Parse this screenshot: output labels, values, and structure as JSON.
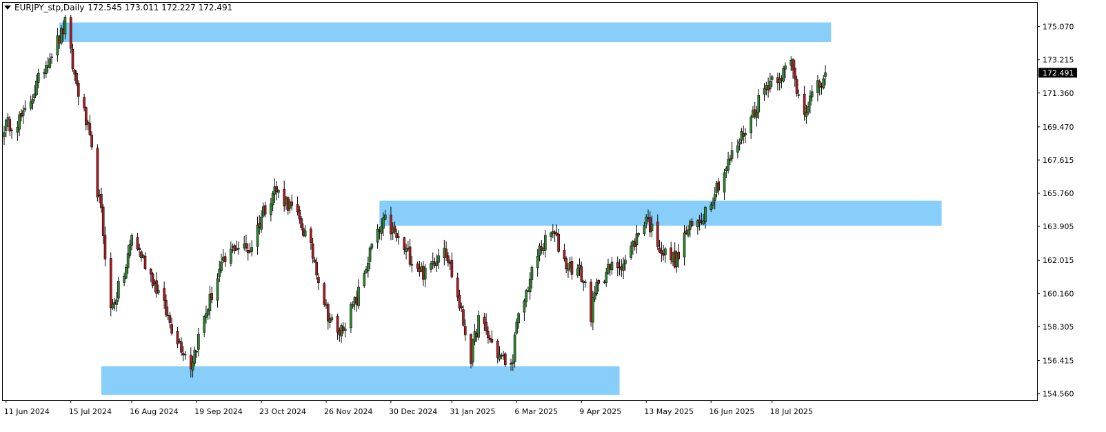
{
  "header": {
    "symbol": "EURJPY_stp,Daily",
    "ohlc": "172.545 173.011 172.227 172.491"
  },
  "colors": {
    "zone": "#87cefa",
    "bull": "#2e8b2e",
    "bear": "#b01d22",
    "wick": "#000000",
    "price_label_bg": "#000000",
    "price_label_text": "#ffffff"
  },
  "chart_data": {
    "type": "candlestick",
    "symbol": "EURJPY_stp",
    "timeframe": "Daily",
    "last_price": "172.491",
    "y_ticks": [
      "175.070",
      "173.215",
      "171.360",
      "169.470",
      "167.615",
      "165.760",
      "163.905",
      "162.015",
      "160.160",
      "158.305",
      "156.415",
      "154.560"
    ],
    "x_ticks": [
      "11 Jun 2024",
      "15 Jul 2024",
      "16 Aug 2024",
      "19 Sep 2024",
      "23 Oct 2024",
      "26 Nov 2024",
      "30 Dec 2024",
      "31 Jan 2025",
      "6 Mar 2025",
      "9 Apr 2025",
      "13 May 2025",
      "16 Jun 2025",
      "18 Jul 2025"
    ],
    "ylim": [
      154.2,
      176.4
    ],
    "zones": [
      {
        "x_from": "2024-07-09",
        "x_to": "2025-08-18",
        "y_low": 174.2,
        "y_high": 175.3
      },
      {
        "x_from": "2024-12-24",
        "x_to": "2025-10-15",
        "y_low": 163.95,
        "y_high": 165.35
      },
      {
        "x_from": "2024-07-31",
        "x_to": "2025-04-29",
        "y_low": 154.5,
        "y_high": 156.1
      }
    ],
    "path": [
      {
        "t": "2024-06-10",
        "p": 169.5
      },
      {
        "t": "2024-06-20",
        "p": 170.0
      },
      {
        "t": "2024-07-03",
        "p": 173.3
      },
      {
        "t": "2024-07-10",
        "p": 174.6
      },
      {
        "t": "2024-07-12",
        "p": 175.2
      },
      {
        "t": "2024-07-17",
        "p": 172.3
      },
      {
        "t": "2024-07-24",
        "p": 169.3
      },
      {
        "t": "2024-07-31",
        "p": 164.6
      },
      {
        "t": "2024-08-05",
        "p": 159.2
      },
      {
        "t": "2024-08-07",
        "p": 159.8
      },
      {
        "t": "2024-08-13",
        "p": 161.6
      },
      {
        "t": "2024-08-16",
        "p": 163.4
      },
      {
        "t": "2024-08-27",
        "p": 161.0
      },
      {
        "t": "2024-09-06",
        "p": 158.3
      },
      {
        "t": "2024-09-16",
        "p": 156.2
      },
      {
        "t": "2024-09-23",
        "p": 158.8
      },
      {
        "t": "2024-10-01",
        "p": 161.4
      },
      {
        "t": "2024-10-09",
        "p": 162.8
      },
      {
        "t": "2024-10-17",
        "p": 162.6
      },
      {
        "t": "2024-10-24",
        "p": 164.8
      },
      {
        "t": "2024-10-30",
        "p": 166.0
      },
      {
        "t": "2024-11-06",
        "p": 165.2
      },
      {
        "t": "2024-11-13",
        "p": 164.0
      },
      {
        "t": "2024-11-20",
        "p": 162.0
      },
      {
        "t": "2024-11-26",
        "p": 159.3
      },
      {
        "t": "2024-12-02",
        "p": 157.8
      },
      {
        "t": "2024-12-12",
        "p": 159.8
      },
      {
        "t": "2024-12-20",
        "p": 162.8
      },
      {
        "t": "2024-12-27",
        "p": 164.2
      },
      {
        "t": "2025-01-07",
        "p": 162.5
      },
      {
        "t": "2025-01-17",
        "p": 161.2
      },
      {
        "t": "2025-01-27",
        "p": 163.0
      },
      {
        "t": "2025-02-04",
        "p": 159.5
      },
      {
        "t": "2025-02-10",
        "p": 156.6
      },
      {
        "t": "2025-02-14",
        "p": 158.7
      },
      {
        "t": "2025-02-24",
        "p": 156.8
      },
      {
        "t": "2025-03-03",
        "p": 156.0
      },
      {
        "t": "2025-03-06",
        "p": 158.3
      },
      {
        "t": "2025-03-12",
        "p": 160.6
      },
      {
        "t": "2025-03-18",
        "p": 162.6
      },
      {
        "t": "2025-03-25",
        "p": 163.6
      },
      {
        "t": "2025-03-28",
        "p": 162.8
      },
      {
        "t": "2025-04-01",
        "p": 161.8
      },
      {
        "t": "2025-04-08",
        "p": 161.4
      },
      {
        "t": "2025-04-11",
        "p": 160.6
      },
      {
        "t": "2025-04-14",
        "p": 159.0
      },
      {
        "t": "2025-04-18",
        "p": 161.0
      },
      {
        "t": "2025-04-25",
        "p": 161.6
      },
      {
        "t": "2025-05-02",
        "p": 162.0
      },
      {
        "t": "2025-05-08",
        "p": 163.3
      },
      {
        "t": "2025-05-13",
        "p": 164.5
      },
      {
        "t": "2025-05-16",
        "p": 163.7
      },
      {
        "t": "2025-05-22",
        "p": 162.4
      },
      {
        "t": "2025-05-29",
        "p": 162.0
      },
      {
        "t": "2025-06-03",
        "p": 163.6
      },
      {
        "t": "2025-06-10",
        "p": 164.2
      },
      {
        "t": "2025-06-16",
        "p": 165.5
      },
      {
        "t": "2025-06-23",
        "p": 167.0
      },
      {
        "t": "2025-06-30",
        "p": 168.5
      },
      {
        "t": "2025-07-07",
        "p": 170.0
      },
      {
        "t": "2025-07-14",
        "p": 171.6
      },
      {
        "t": "2025-07-18",
        "p": 172.2
      },
      {
        "t": "2025-07-24",
        "p": 172.5
      },
      {
        "t": "2025-07-28",
        "p": 173.0
      },
      {
        "t": "2025-07-31",
        "p": 171.6
      },
      {
        "t": "2025-08-04",
        "p": 170.5
      },
      {
        "t": "2025-08-08",
        "p": 171.2
      },
      {
        "t": "2025-08-13",
        "p": 171.9
      },
      {
        "t": "2025-08-15",
        "p": 172.49
      }
    ]
  }
}
